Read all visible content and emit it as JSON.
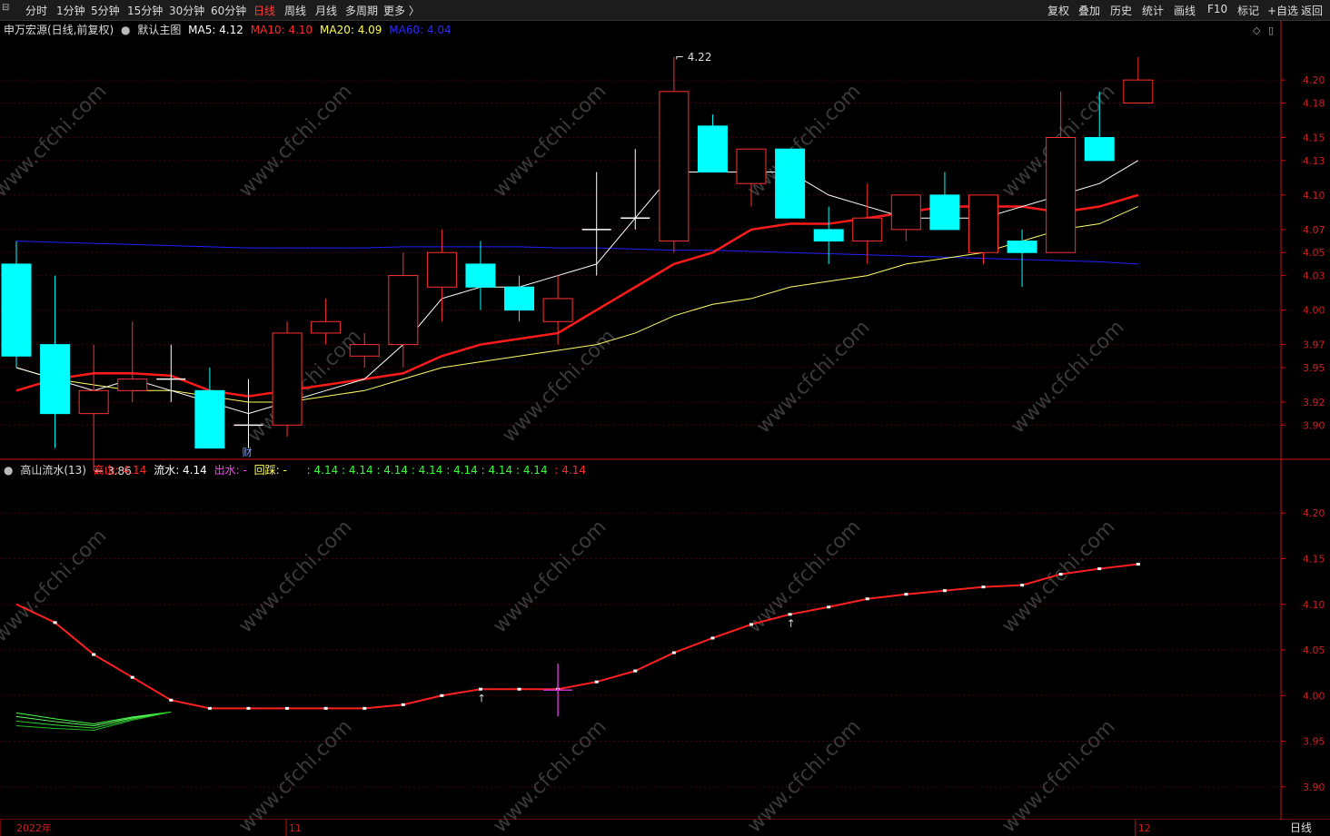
{
  "toolbar": {
    "left": [
      "分时",
      "1分钟",
      "5分钟",
      "15分钟",
      "30分钟",
      "60分钟",
      "日线",
      "周线",
      "月线",
      "多周期",
      "更多 〉"
    ],
    "active": "日线",
    "right": [
      "复权",
      "叠加",
      "历史",
      "统计",
      "画线",
      "F10",
      "标记",
      "+自选",
      "返回"
    ]
  },
  "main_header": {
    "stock": "申万宏源(日线,前复权)",
    "indicator": "默认主图",
    "ma5": "MA5: 4.12",
    "ma10": "MA10: 4.10",
    "ma20": "MA20: 4.09",
    "ma60": "MA60: 4.04"
  },
  "sub_header": {
    "name": "高山流水(13)",
    "gaoshan": "高山: 4.14",
    "liushui": "流水: 4.14",
    "chushui": "出水: -",
    "huicai": "回踩: -",
    "values": ": 4.14 : 4.14 : 4.14 : 4.14 : 4.14 : 4.14 : 4.14",
    "last": ": 4.14"
  },
  "colors": {
    "up": "#ff3030",
    "down": "#00ffff",
    "ma5": "#ffffff",
    "ma10": "#ff1a1a",
    "ma20": "#ffff66",
    "ma60": "#2020ff",
    "grid": "#4a0000",
    "axis": "#cc1010"
  },
  "main_axis_ticks": [
    "4.20",
    "4.18",
    "4.15",
    "4.13",
    "4.10",
    "4.07",
    "4.05",
    "4.03",
    "4.00",
    "3.97",
    "3.95",
    "3.92",
    "3.90"
  ],
  "sub_axis_ticks": [
    "4.20",
    "4.15",
    "4.10",
    "4.05",
    "4.00",
    "3.95",
    "3.90"
  ],
  "date_labels": [
    "2022年",
    "11",
    "12"
  ],
  "period_label": "日线",
  "annotations": {
    "high": "4.22",
    "low": "3.86",
    "news": "财"
  },
  "watermark": "www.cfchi.com",
  "chart_data": {
    "type": "candlestick",
    "candles": [
      {
        "o": 4.04,
        "h": 4.06,
        "l": 3.95,
        "c": 3.96
      },
      {
        "o": 3.97,
        "h": 4.03,
        "l": 3.88,
        "c": 3.91
      },
      {
        "o": 3.91,
        "h": 3.97,
        "l": 3.86,
        "c": 3.93
      },
      {
        "o": 3.93,
        "h": 3.99,
        "l": 3.92,
        "c": 3.94
      },
      {
        "o": 3.94,
        "h": 3.97,
        "l": 3.92,
        "c": 3.94
      },
      {
        "o": 3.93,
        "h": 3.95,
        "l": 3.88,
        "c": 3.88
      },
      {
        "o": 3.9,
        "h": 3.94,
        "l": 3.88,
        "c": 3.9
      },
      {
        "o": 3.9,
        "h": 3.99,
        "l": 3.89,
        "c": 3.98
      },
      {
        "o": 3.98,
        "h": 4.01,
        "l": 3.97,
        "c": 3.99
      },
      {
        "o": 3.96,
        "h": 3.98,
        "l": 3.95,
        "c": 3.97
      },
      {
        "o": 3.97,
        "h": 4.05,
        "l": 3.95,
        "c": 4.03
      },
      {
        "o": 4.02,
        "h": 4.07,
        "l": 3.99,
        "c": 4.05
      },
      {
        "o": 4.04,
        "h": 4.06,
        "l": 4.0,
        "c": 4.02
      },
      {
        "o": 4.02,
        "h": 4.03,
        "l": 3.99,
        "c": 4.0
      },
      {
        "o": 3.99,
        "h": 4.03,
        "l": 3.97,
        "c": 4.01
      },
      {
        "o": 4.07,
        "h": 4.12,
        "l": 4.03,
        "c": 4.07
      },
      {
        "o": 4.08,
        "h": 4.14,
        "l": 4.07,
        "c": 4.08
      },
      {
        "o": 4.06,
        "h": 4.22,
        "l": 4.05,
        "c": 4.19
      },
      {
        "o": 4.16,
        "h": 4.17,
        "l": 4.12,
        "c": 4.12
      },
      {
        "o": 4.11,
        "h": 4.14,
        "l": 4.09,
        "c": 4.14
      },
      {
        "o": 4.14,
        "h": 4.14,
        "l": 4.08,
        "c": 4.08
      },
      {
        "o": 4.07,
        "h": 4.09,
        "l": 4.04,
        "c": 4.06
      },
      {
        "o": 4.06,
        "h": 4.11,
        "l": 4.04,
        "c": 4.08
      },
      {
        "o": 4.07,
        "h": 4.1,
        "l": 4.06,
        "c": 4.1
      },
      {
        "o": 4.1,
        "h": 4.12,
        "l": 4.07,
        "c": 4.07
      },
      {
        "o": 4.05,
        "h": 4.1,
        "l": 4.04,
        "c": 4.1
      },
      {
        "o": 4.06,
        "h": 4.07,
        "l": 4.02,
        "c": 4.05
      },
      {
        "o": 4.05,
        "h": 4.19,
        "l": 4.05,
        "c": 4.15
      },
      {
        "o": 4.15,
        "h": 4.19,
        "l": 4.13,
        "c": 4.13
      },
      {
        "o": 4.18,
        "h": 4.22,
        "l": 4.18,
        "c": 4.2
      }
    ],
    "ma5": [
      3.95,
      3.94,
      3.93,
      3.94,
      3.93,
      3.92,
      3.91,
      3.92,
      3.93,
      3.94,
      3.97,
      4.01,
      4.02,
      4.02,
      4.03,
      4.04,
      4.08,
      4.12,
      4.12,
      4.12,
      4.12,
      4.1,
      4.09,
      4.08,
      4.08,
      4.08,
      4.09,
      4.1,
      4.11,
      4.13
    ],
    "ma10": [
      3.93,
      3.94,
      3.945,
      3.945,
      3.943,
      3.93,
      3.925,
      3.93,
      3.935,
      3.94,
      3.945,
      3.96,
      3.97,
      3.975,
      3.98,
      4.0,
      4.02,
      4.04,
      4.05,
      4.07,
      4.075,
      4.075,
      4.08,
      4.085,
      4.09,
      4.09,
      4.09,
      4.085,
      4.09,
      4.1
    ],
    "ma20": [
      3.95,
      3.94,
      3.935,
      3.93,
      3.93,
      3.925,
      3.92,
      3.92,
      3.925,
      3.93,
      3.94,
      3.95,
      3.955,
      3.96,
      3.965,
      3.97,
      3.98,
      3.995,
      4.005,
      4.01,
      4.02,
      4.025,
      4.03,
      4.04,
      4.045,
      4.05,
      4.06,
      4.07,
      4.075,
      4.09
    ],
    "ma60": [
      4.06,
      4.059,
      4.058,
      4.057,
      4.056,
      4.055,
      4.054,
      4.054,
      4.054,
      4.054,
      4.055,
      4.055,
      4.055,
      4.055,
      4.054,
      4.054,
      4.053,
      4.052,
      4.052,
      4.051,
      4.05,
      4.049,
      4.048,
      4.047,
      4.046,
      4.045,
      4.044,
      4.043,
      4.042,
      4.04
    ],
    "gaoshan": [
      4.1,
      4.08,
      4.045,
      4.02,
      3.995,
      3.986,
      3.986,
      3.986,
      3.986,
      3.986,
      3.99,
      4.0,
      4.007,
      4.007,
      4.007,
      4.015,
      4.027,
      4.047,
      4.063,
      4.078,
      4.089,
      4.097,
      4.106,
      4.111,
      4.115,
      4.119,
      4.121,
      4.133,
      4.139,
      4.144
    ],
    "liushui_start": [
      3.975,
      3.97,
      3.966,
      3.975,
      3.982
    ],
    "main_ylim": [
      3.875,
      4.238
    ],
    "sub_ylim": [
      3.865,
      4.245
    ]
  }
}
